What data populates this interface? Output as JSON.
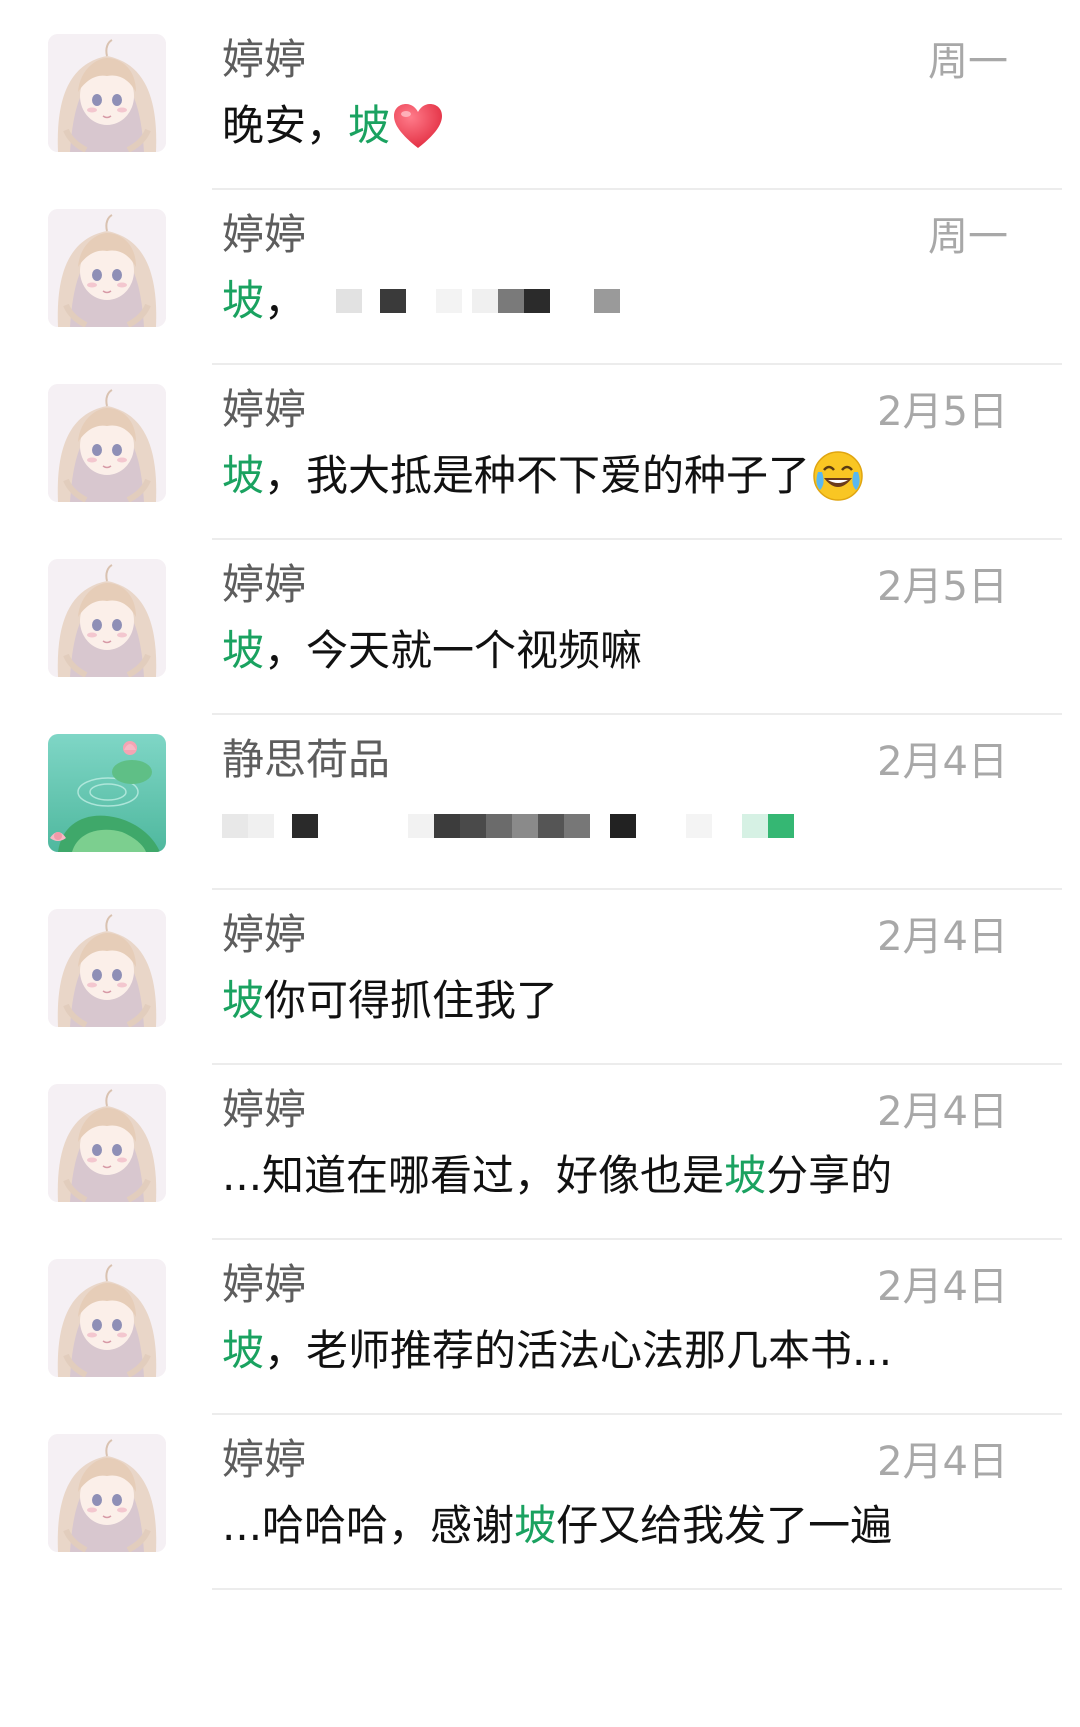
{
  "chats": [
    {
      "name": "婷婷",
      "time": "周一",
      "avatar": "girl-avatar-icon",
      "message": [
        {
          "t": "晚安，"
        },
        {
          "t": "坡",
          "hl": true
        }
      ],
      "emoji": "heart-emoji"
    },
    {
      "name": "婷婷",
      "time": "周一",
      "avatar": "girl-avatar-icon",
      "message": [
        {
          "t": "坡",
          "hl": true
        },
        {
          "t": "，"
        }
      ],
      "redacted": true
    },
    {
      "name": "婷婷",
      "time": "2月5日",
      "avatar": "girl-avatar-icon",
      "message": [
        {
          "t": "坡",
          "hl": true
        },
        {
          "t": "，我大抵是种不下爱的种子了"
        }
      ],
      "emoji": "laughing-crying-emoji"
    },
    {
      "name": "婷婷",
      "time": "2月5日",
      "avatar": "girl-avatar-icon",
      "message": [
        {
          "t": "坡",
          "hl": true
        },
        {
          "t": "，今天就一个视频嘛"
        }
      ]
    },
    {
      "name": "静思荷品",
      "time": "2月4日",
      "avatar": "lotus-avatar-icon",
      "message": [],
      "redacted": true
    },
    {
      "name": "婷婷",
      "time": "2月4日",
      "avatar": "girl-avatar-icon",
      "message": [
        {
          "t": "坡",
          "hl": true
        },
        {
          "t": " 你可得抓住我了"
        }
      ]
    },
    {
      "name": "婷婷",
      "time": "2月4日",
      "avatar": "girl-avatar-icon",
      "message": [
        {
          "t": "...知道在哪看过，好像也是"
        },
        {
          "t": "坡",
          "hl": true
        },
        {
          "t": "分享的"
        }
      ]
    },
    {
      "name": "婷婷",
      "time": "2月4日",
      "avatar": "girl-avatar-icon",
      "message": [
        {
          "t": "坡",
          "hl": true
        },
        {
          "t": "，老师推荐的活法心法那几本书..."
        }
      ]
    },
    {
      "name": "婷婷",
      "time": "2月4日",
      "avatar": "girl-avatar-icon",
      "message": [
        {
          "t": "...哈哈哈，感谢"
        },
        {
          "t": "坡",
          "hl": true
        },
        {
          "t": "仔又给我发了一遍"
        }
      ]
    }
  ],
  "colors": {
    "highlight": "#1aa260",
    "name": "#5d5d5d",
    "time": "#a8a8a8",
    "divider": "#ececec"
  }
}
